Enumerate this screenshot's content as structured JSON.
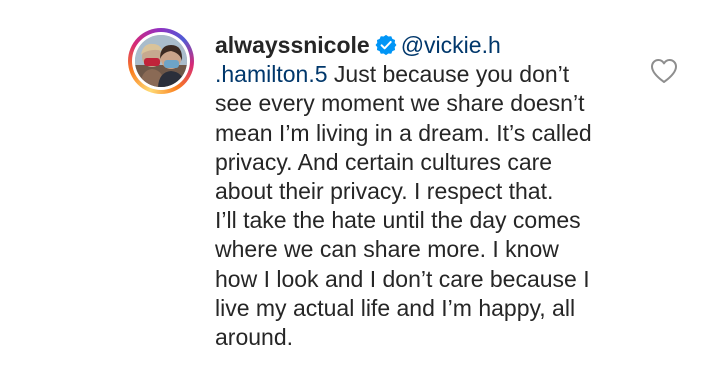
{
  "comment": {
    "username": "alwayssnicole",
    "verified_icon": "verified-badge-icon",
    "mention_part1": "@vickie.h",
    "mention_part2": ".hamilton.5",
    "line1_rest": " Just because you don’t",
    "lines": [
      "see every moment we share doesn’t",
      "mean I’m living in a dream. It’s called",
      "privacy. And certain cultures care",
      "about their privacy. I respect that.",
      "I’ll take the hate until the day comes",
      "where we can share more. I know",
      "how I look and I don’t care because I",
      "live my actual life and I’m happy, all",
      "around."
    ],
    "like_icon": "heart-outline-icon",
    "avatar_icon": "profile-photo"
  },
  "colors": {
    "text": "#262626",
    "mention": "#00376b",
    "verified": "#0095f6",
    "like_outline": "#8e8e8e"
  }
}
